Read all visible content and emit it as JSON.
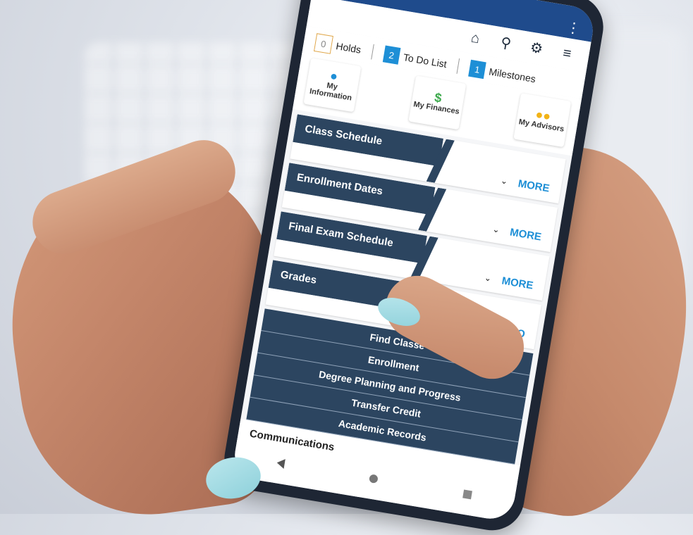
{
  "top_bar": {
    "icons": [
      "home-icon",
      "search-icon",
      "gear-icon",
      "hamburger-menu-icon"
    ]
  },
  "counts": {
    "holds_count": "0",
    "holds_label": "Holds",
    "todo_count": "2",
    "todo_label": "To Do List",
    "milestones_count": "1",
    "milestones_label": "Milestones"
  },
  "tiles": [
    {
      "label": "My Information",
      "icon": "person-icon",
      "color": "#1e8fd6"
    },
    {
      "label": "My Finances",
      "icon": "dollar-icon",
      "color": "#3aa84a"
    },
    {
      "label": "My Advisors",
      "icon": "people-icon",
      "color": "#f2b317"
    }
  ],
  "sections": [
    {
      "title": "Class Schedule",
      "more": "MORE"
    },
    {
      "title": "Enrollment Dates",
      "more": "MORE"
    },
    {
      "title": "Final Exam Schedule",
      "more": "MORE"
    },
    {
      "title": "Grades",
      "more": "MO"
    }
  ],
  "menu": [
    "Find Classe",
    "Enrollment",
    "Degree Planning and Progress",
    "Transfer Credit",
    "Academic Records"
  ],
  "communications": "Communications",
  "colors": {
    "status_bar": "#1f4b8c",
    "section_header": "#2c4560",
    "accent_blue": "#1e8fd6",
    "nail_polish": "#9fdbe3"
  }
}
